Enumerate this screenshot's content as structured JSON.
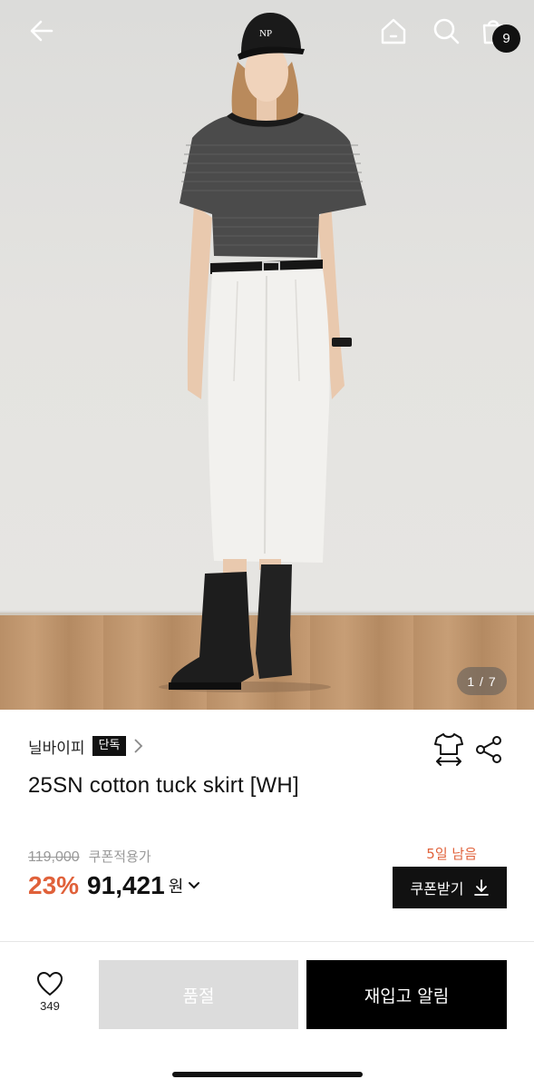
{
  "header": {
    "back_icon": "arrow-left-icon",
    "home_icon": "home-icon",
    "search_icon": "search-icon",
    "cart_icon": "shopping-bag-icon",
    "cart_count": "9"
  },
  "gallery": {
    "counter": "1 / 7",
    "cap_logo": "NP"
  },
  "product": {
    "brand": "닐바이피",
    "exclusive_badge": "단독",
    "title": "25SN cotton tuck skirt [WH]",
    "original_price": "119,000",
    "coupon_note": "쿠폰적용가",
    "discount": "23%",
    "sale_price": "91,421",
    "currency": "원",
    "days_left": "5일 남음",
    "coupon_button": "쿠폰받기"
  },
  "bottom_bar": {
    "like_count": "349",
    "soldout_label": "품절",
    "restock_label": "재입고 알림"
  },
  "colors": {
    "accent": "#e0613a",
    "primary": "#111111",
    "disabled": "#dcdcdc"
  }
}
